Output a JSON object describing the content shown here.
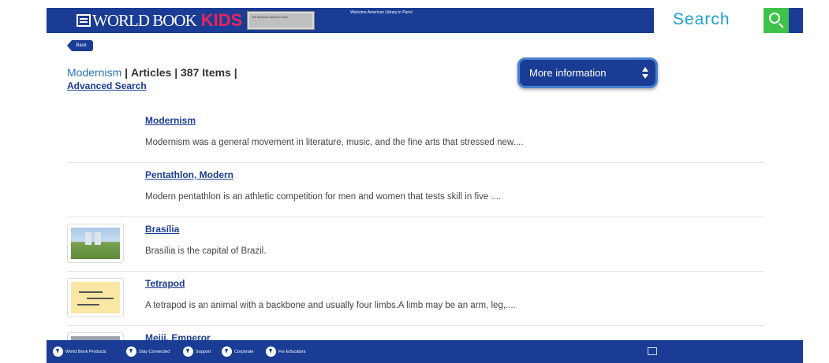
{
  "header": {
    "logo_text": "WORLD BOOK",
    "logo_kids": "KIDS",
    "library_badge": "The American Library in Paris",
    "welcome": "Welcome American Library in Paris!",
    "search_label": "Search"
  },
  "nav": {
    "back_label": "Back"
  },
  "breadcrumb": {
    "term": "Modernism",
    "separator": "|",
    "type": "Articles",
    "count": "387 Items",
    "advanced_search": "Advanced Search"
  },
  "more_info_label": "More information",
  "results": [
    {
      "title": "Modernism",
      "description": "Modernism was a general movement in literature, music, and the fine arts that stressed new....",
      "thumbnail": null
    },
    {
      "title": "Pentathlon, Modern",
      "description": "Modern pentathlon is an athletic competition for men and women that tests skill in five ....",
      "thumbnail": null
    },
    {
      "title": "Brasília",
      "description": "Brasília is the capital of Brazil.",
      "thumbnail": "brasilia-image"
    },
    {
      "title": "Tetrapod",
      "description": "A tetrapod is an animal with a backbone and usually four limbs.A limb may be an arm, leg,....",
      "thumbnail": "tetrapod-image"
    },
    {
      "title": "Meiji, Emperor",
      "description": "",
      "thumbnail": "meiji-image"
    }
  ],
  "footer": {
    "links": [
      "World Book Products",
      "Stay Connected",
      "Support",
      "Corporate",
      "For Educators"
    ]
  },
  "colors": {
    "brand_blue": "#1a3c94",
    "kids_pink": "#e8245b",
    "search_teal": "#1aa0d8",
    "search_green": "#3fc24a"
  }
}
